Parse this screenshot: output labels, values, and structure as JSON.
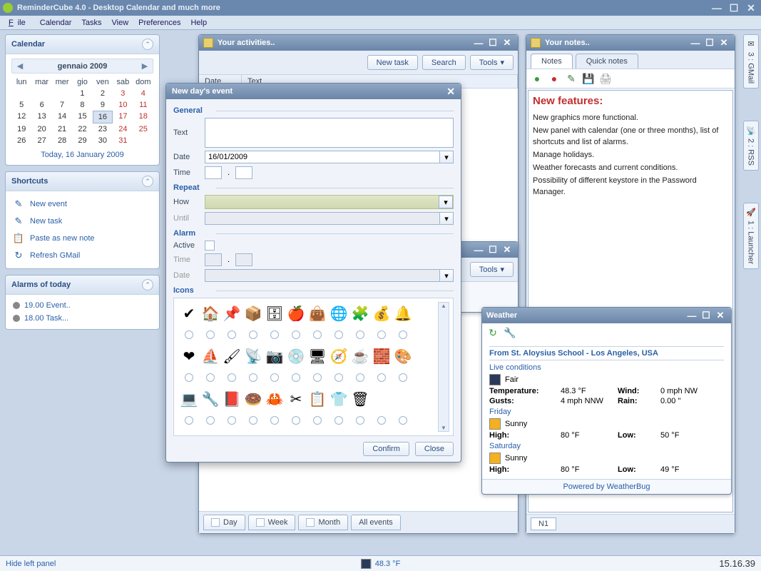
{
  "app": {
    "title": "ReminderCube 4.0 - Desktop Calendar and much more"
  },
  "menu": {
    "file": "File",
    "calendar": "Calendar",
    "tasks": "Tasks",
    "view": "View",
    "preferences": "Preferences",
    "help": "Help"
  },
  "calendar_panel": {
    "title": "Calendar",
    "month": "gennaio 2009",
    "dow": [
      "lun",
      "mar",
      "mer",
      "gio",
      "ven",
      "sab",
      "dom"
    ],
    "weeks": [
      [
        "",
        "",
        "",
        "1",
        "2",
        "3",
        "4"
      ],
      [
        "5",
        "6",
        "7",
        "8",
        "9",
        "10",
        "11"
      ],
      [
        "12",
        "13",
        "14",
        "15",
        "16",
        "17",
        "18"
      ],
      [
        "19",
        "20",
        "21",
        "22",
        "23",
        "24",
        "25"
      ],
      [
        "26",
        "27",
        "28",
        "29",
        "30",
        "31",
        ""
      ]
    ],
    "today_day": "16",
    "today_text": "Today, 16 January 2009"
  },
  "shortcuts": {
    "title": "Shortcuts",
    "items": [
      {
        "icon": "✎",
        "label": "New event"
      },
      {
        "icon": "✎",
        "label": "New task"
      },
      {
        "icon": "📋",
        "label": "Paste as new note"
      },
      {
        "icon": "↻",
        "label": "Refresh GMail"
      }
    ]
  },
  "alarms": {
    "title": "Alarms of today",
    "items": [
      {
        "label": "19.00 Event.."
      },
      {
        "label": "18.00 Task..."
      }
    ]
  },
  "activities": {
    "title": "Your activities..",
    "new_task": "New task",
    "search": "Search",
    "tools": "Tools",
    "col_date": "Date",
    "col_text": "Text",
    "tabs": {
      "day": "Day",
      "week": "Week",
      "month": "Month",
      "all": "All events"
    }
  },
  "lower_panel": {
    "tools": "Tools"
  },
  "notes": {
    "title": "Your notes..",
    "tab_notes": "Notes",
    "tab_quick": "Quick notes",
    "heading": "New features:",
    "lines": [
      "New graphics more functional.",
      "New panel with calendar (one or three months), list of shortcuts and list of alarms.",
      "Manage holidays.",
      "Weather forecasts and current conditions.",
      "Possibility of different keystore in the Password Manager."
    ],
    "footer": "N1"
  },
  "sidetabs": {
    "gmail": "3 : GMail",
    "rss": "2 : RSS",
    "launcher": "1 : Launcher"
  },
  "dialog": {
    "title": "New day's event",
    "sec_general": "General",
    "lbl_text": "Text",
    "lbl_date": "Date",
    "date_value": "16/01/2009",
    "lbl_time": "Time",
    "time_sep": ".",
    "sec_repeat": "Repeat",
    "lbl_how": "How",
    "lbl_until": "Until",
    "sec_alarm": "Alarm",
    "lbl_active": "Active",
    "lbl_atime": "Time",
    "lbl_adate": "Date",
    "sec_icons": "Icons",
    "btn_confirm": "Confirm",
    "btn_close": "Close",
    "icons": [
      "✔",
      "🏠",
      "📌",
      "📦",
      "🗄",
      "🍎",
      "👜",
      "🌐",
      "🧩",
      "💰",
      "🔔",
      "❤",
      "⛵",
      "🖌",
      "📡",
      "📷",
      "💿",
      "🖥",
      "🧭",
      "☕",
      "🧱",
      "🎨",
      "💻",
      "🔧",
      "📕",
      "🍩",
      "🦀",
      "✂",
      "📋",
      "👕",
      "🗑"
    ]
  },
  "weather": {
    "title": "Weather",
    "location": "From St. Aloysius School - Los Angeles, USA",
    "live": "Live conditions",
    "cond": "Fair",
    "temp_lbl": "Temperature:",
    "temp_val": "48.3 °F",
    "wind_lbl": "Wind:",
    "wind_val": "0 mph NW",
    "gusts_lbl": "Gusts:",
    "gusts_val": "4 mph NNW",
    "rain_lbl": "Rain:",
    "rain_val": "0.00 \"",
    "d1": "Friday",
    "d1_cond": "Sunny",
    "d1_high_lbl": "High:",
    "d1_high": "80 °F",
    "d1_low_lbl": "Low:",
    "d1_low": "50 °F",
    "d2": "Saturday",
    "d2_cond": "Sunny",
    "d2_high_lbl": "High:",
    "d2_high": "80 °F",
    "d2_low_lbl": "Low:",
    "d2_low": "49 °F",
    "powered": "Powered by WeatherBug"
  },
  "statusbar": {
    "left": "Hide left panel",
    "temp": "48.3 °F",
    "time": "15.16.39"
  }
}
